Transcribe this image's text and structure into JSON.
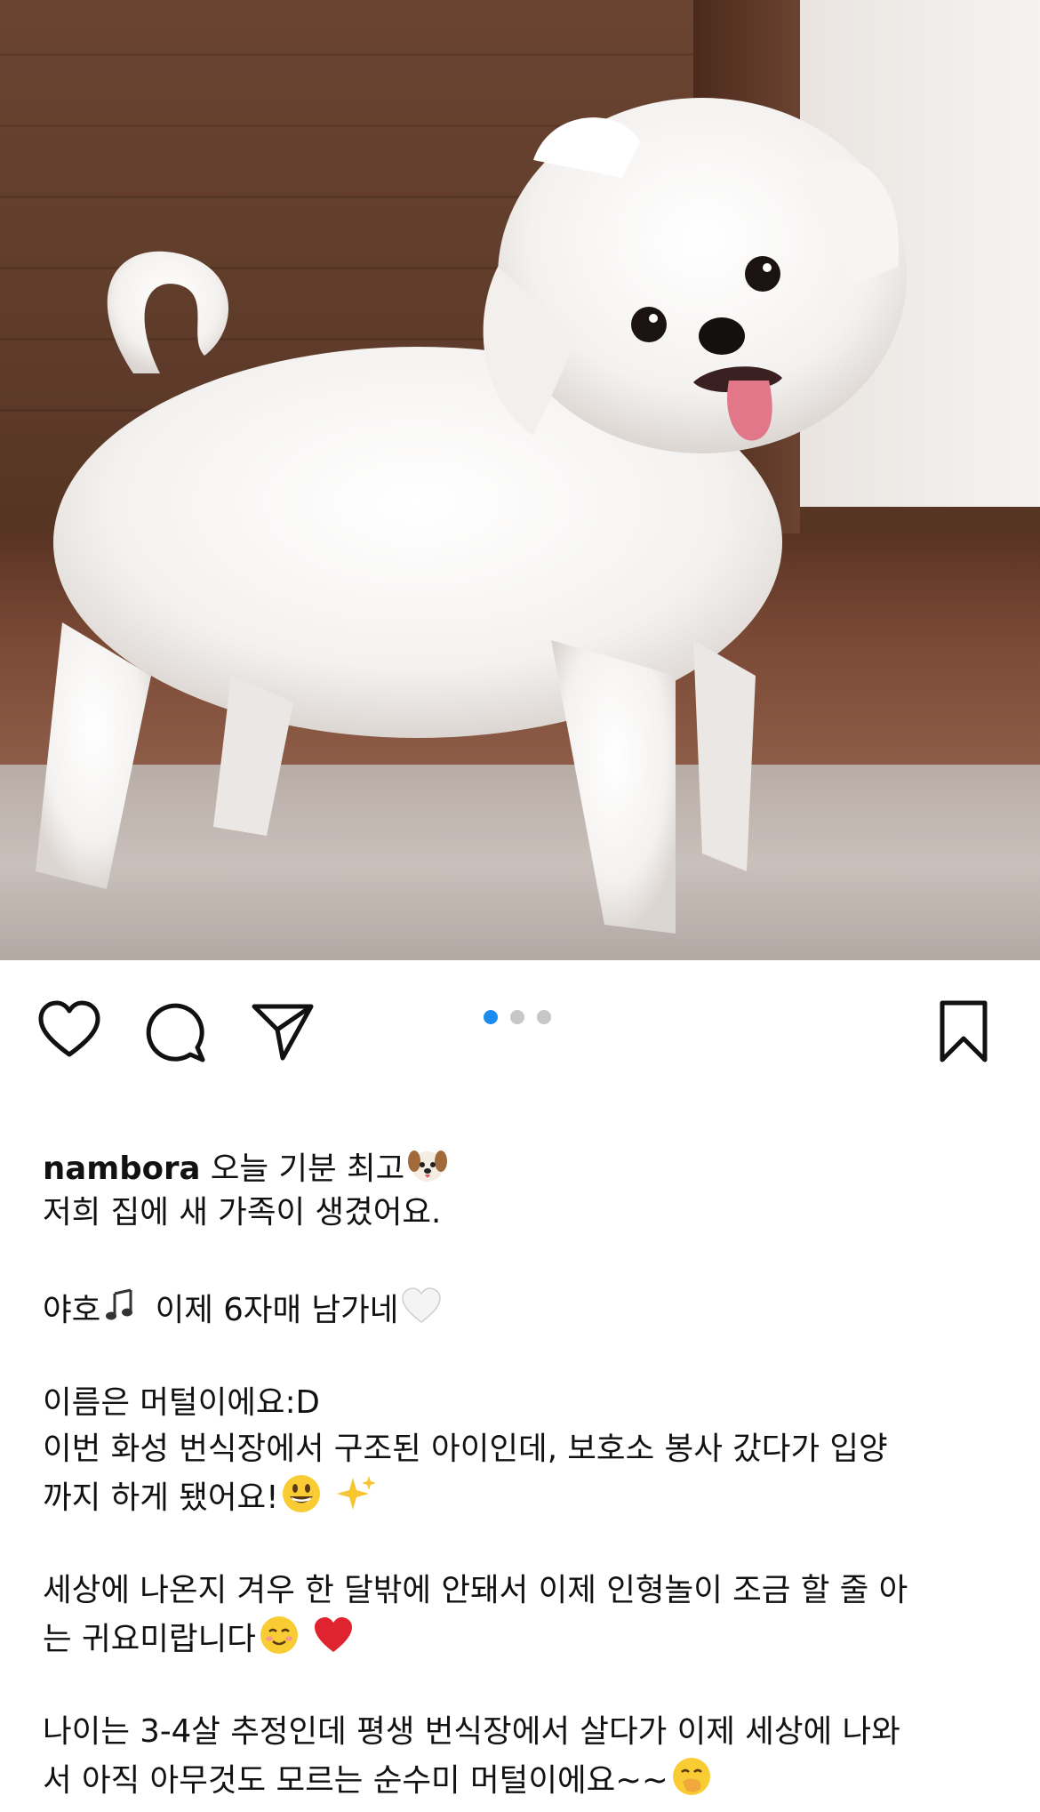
{
  "post": {
    "photo": {
      "subject": "white maltese puppy standing on carpet",
      "alt_icon": "photo"
    },
    "carousel": {
      "count": 3,
      "active_index": 0
    },
    "actions": {
      "like_icon": "heart-outline-icon",
      "comment_icon": "comment-bubble-icon",
      "share_icon": "paper-plane-icon",
      "save_icon": "bookmark-outline-icon"
    },
    "colors": {
      "active_dot": "#1a8cf0",
      "inactive_dot": "#c7c7c7"
    },
    "caption": {
      "username": "nambora",
      "line1_rest": " 오늘 기분 최고",
      "line2": "저희 집에 새 가족이 생겼어요.",
      "line3_a": "야호",
      "line3_b": " 이제 6자매 남가네",
      "line4": "이름은 머털이에요:D",
      "line5": "이번 화성 번식장에서 구조된 아이인데, 보호소 봉사 갔다가 입양",
      "line6": "까지 하게 됐어요!",
      "line7": "세상에 나온지 겨우 한 달밖에 안돼서 이제 인형놀이 조금 할 줄 아",
      "line8": "는 귀요미랍니다",
      "line9": "나이는 3-4살 추정인데 평생 번식장에서 살다가 이제 세상에 나와",
      "line10": "서 아직 아무것도 모르는 순수미 머털이에요~~"
    },
    "emojis": {
      "dog_face": "dog-face-emoji",
      "music_notes": "musical-notes-emoji",
      "white_heart": "white-heart-emoji",
      "grinning": "grinning-face-emoji",
      "sparkles": "sparkles-emoji",
      "smiling": "smiling-face-emoji",
      "red_heart": "red-heart-emoji",
      "hand_over_mouth": "face-with-hand-over-mouth-emoji"
    }
  }
}
